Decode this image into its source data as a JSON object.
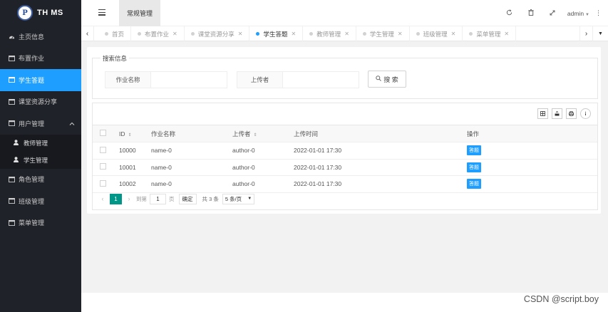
{
  "app": {
    "logo_letter": "P",
    "title": "TH MS"
  },
  "sidebar": {
    "items": [
      {
        "label": "主页信息",
        "icon": "dashboard-icon"
      },
      {
        "label": "布置作业",
        "icon": "window-icon"
      },
      {
        "label": "学生答题",
        "icon": "window-icon",
        "active": true
      },
      {
        "label": "课堂资源分享",
        "icon": "window-icon"
      },
      {
        "label": "用户管理",
        "icon": "window-icon",
        "expanded": true
      }
    ],
    "sub_items": [
      {
        "label": "教师管理",
        "icon": "user-icon"
      },
      {
        "label": "学生管理",
        "icon": "user-icon"
      }
    ],
    "items_after": [
      {
        "label": "角色管理",
        "icon": "window-icon"
      },
      {
        "label": "班级管理",
        "icon": "window-icon"
      },
      {
        "label": "菜单管理",
        "icon": "window-icon"
      }
    ]
  },
  "header": {
    "tab_label": "常规管理",
    "user": "admin"
  },
  "tabbar": {
    "tabs": [
      {
        "label": "首页",
        "closable": false
      },
      {
        "label": "布置作业",
        "closable": true
      },
      {
        "label": "课堂资源分享",
        "closable": true
      },
      {
        "label": "学生答题",
        "closable": true,
        "active": true
      },
      {
        "label": "教师管理",
        "closable": true
      },
      {
        "label": "学生管理",
        "closable": true
      },
      {
        "label": "班级管理",
        "closable": true
      },
      {
        "label": "菜单管理",
        "closable": true
      }
    ]
  },
  "search": {
    "legend": "搜索信息",
    "field1_label": "作业名称",
    "field1_value": "",
    "field2_label": "上传者",
    "field2_value": "",
    "button_label": "搜 索"
  },
  "table": {
    "columns": [
      "ID",
      "作业名称",
      "上传者",
      "上传时间",
      "操作"
    ],
    "rows": [
      {
        "id": "10000",
        "name": "name-0",
        "author": "author-0",
        "time": "2022-01-01 17:30",
        "action": "答题"
      },
      {
        "id": "10001",
        "name": "name-0",
        "author": "author-0",
        "time": "2022-01-01 17:30",
        "action": "答题"
      },
      {
        "id": "10002",
        "name": "name-0",
        "author": "author-0",
        "time": "2022-01-01 17:30",
        "action": "答题"
      }
    ]
  },
  "pager": {
    "current": "1",
    "goto_label": "到第",
    "goto_value": "1",
    "page_unit": "页",
    "ok_label": "确定",
    "total": "共 3 条",
    "page_size": "5 条/页"
  },
  "watermark": "CSDN @script.boy"
}
